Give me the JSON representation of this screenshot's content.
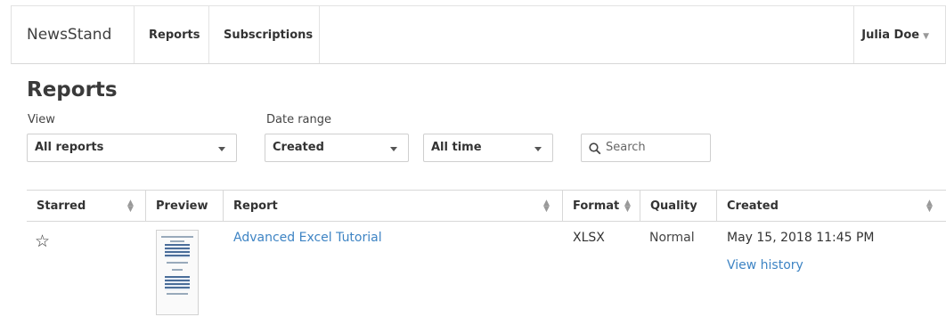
{
  "app": {
    "brand": "NewsStand",
    "user": "Julia Doe"
  },
  "nav": {
    "items": [
      {
        "label": "Reports"
      },
      {
        "label": "Subscriptions"
      }
    ]
  },
  "page": {
    "title": "Reports"
  },
  "filters": {
    "view_label": "View",
    "view_value": "All reports",
    "date_range_label": "Date range",
    "date_field_value": "Created",
    "date_period_value": "All time",
    "search_placeholder": "Search"
  },
  "table": {
    "columns": [
      "Starred",
      "Preview",
      "Report",
      "Format",
      "Quality",
      "Created"
    ],
    "rows": [
      {
        "starred": false,
        "report": "Advanced Excel Tutorial",
        "format": "XLSX",
        "quality": "Normal",
        "created": "May 15, 2018 11:45 PM",
        "history_link": "View history"
      }
    ]
  },
  "icons": {
    "star": "star-outline-icon",
    "search": "search-icon",
    "sort": "sort-icon",
    "dropdown": "caret-down-icon"
  },
  "colors": {
    "link": "#3e84c4",
    "border": "#d8d8d8"
  }
}
